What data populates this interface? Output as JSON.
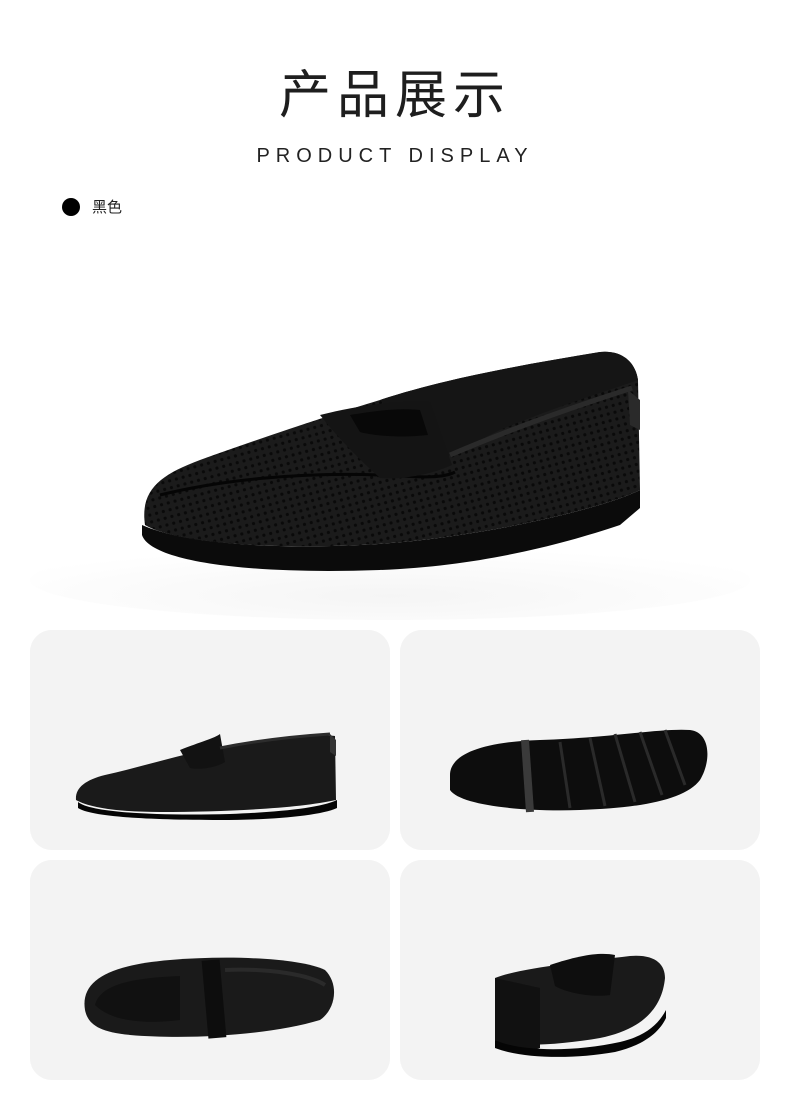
{
  "header": {
    "title_cn": "产品展示",
    "title_en": "PRODUCT DISPLAY"
  },
  "color_option": {
    "label": "黑色",
    "swatch": "#000000"
  },
  "images": {
    "hero": "black-woven-penny-loafer-three-quarter-view",
    "views": [
      "side-view-loafer",
      "outsole-bottom-view",
      "top-down-view",
      "heel-rear-view"
    ]
  }
}
